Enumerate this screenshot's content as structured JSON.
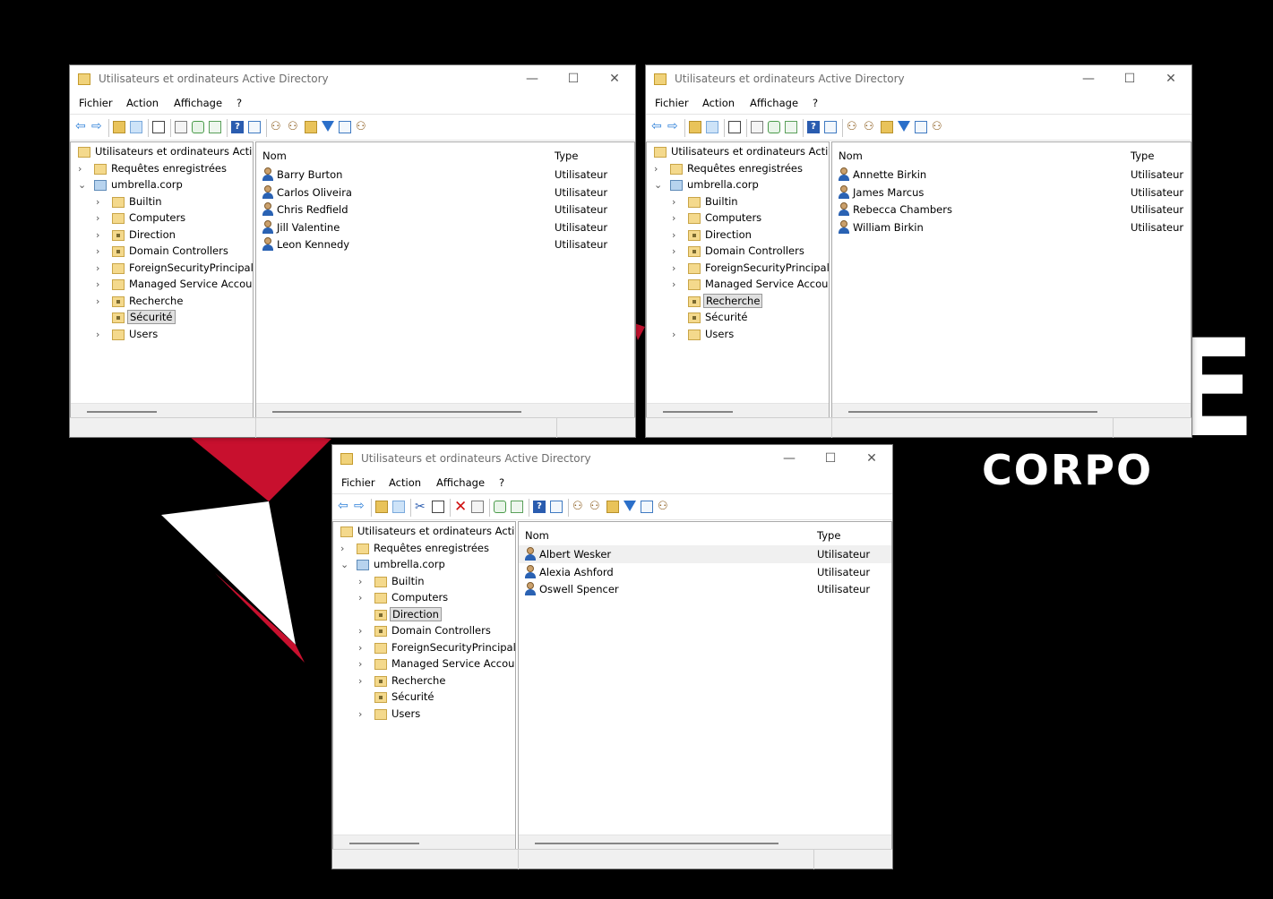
{
  "windows": [
    {
      "title": "Utilisateurs et ordinateurs Active Directory",
      "menu": [
        "Fichier",
        "Action",
        "Affichage",
        "?"
      ],
      "tree_root": "Utilisateurs et ordinateurs Active",
      "saved_queries": "Requêtes enregistrées",
      "domain": "umbrella.corp",
      "ous": [
        "Builtin",
        "Computers",
        "Direction",
        "Domain Controllers",
        "ForeignSecurityPrincipals",
        "Managed Service Accour",
        "Recherche",
        "Sécurité",
        "Users"
      ],
      "selected_ou": "Sécurité",
      "col_name": "Nom",
      "col_type": "Type",
      "rows": [
        {
          "name": "Barry Burton",
          "type": "Utilisateur"
        },
        {
          "name": "Carlos Oliveira",
          "type": "Utilisateur"
        },
        {
          "name": "Chris Redfield",
          "type": "Utilisateur"
        },
        {
          "name": "Jill Valentine",
          "type": "Utilisateur"
        },
        {
          "name": "Leon Kennedy",
          "type": "Utilisateur"
        }
      ]
    },
    {
      "title": "Utilisateurs et ordinateurs Active Directory",
      "menu": [
        "Fichier",
        "Action",
        "Affichage",
        "?"
      ],
      "tree_root": "Utilisateurs et ordinateurs Active",
      "saved_queries": "Requêtes enregistrées",
      "domain": "umbrella.corp",
      "ous": [
        "Builtin",
        "Computers",
        "Direction",
        "Domain Controllers",
        "ForeignSecurityPrincipals",
        "Managed Service Accour",
        "Recherche",
        "Sécurité",
        "Users"
      ],
      "selected_ou": "Recherche",
      "col_name": "Nom",
      "col_type": "Type",
      "rows": [
        {
          "name": "Annette Birkin",
          "type": "Utilisateur"
        },
        {
          "name": "James Marcus",
          "type": "Utilisateur"
        },
        {
          "name": "Rebecca Chambers",
          "type": "Utilisateur"
        },
        {
          "name": "William Birkin",
          "type": "Utilisateur"
        }
      ]
    },
    {
      "title": "Utilisateurs et ordinateurs Active Directory",
      "menu": [
        "Fichier",
        "Action",
        "Affichage",
        "?"
      ],
      "tree_root": "Utilisateurs et ordinateurs Active",
      "saved_queries": "Requêtes enregistrées",
      "domain": "umbrella.corp",
      "ous": [
        "Builtin",
        "Computers",
        "Direction",
        "Domain Controllers",
        "ForeignSecurityPrincipals",
        "Managed Service Accour",
        "Recherche",
        "Sécurité",
        "Users"
      ],
      "selected_ou": "Direction",
      "col_name": "Nom",
      "col_type": "Type",
      "rows": [
        {
          "name": "Albert Wesker",
          "type": "Utilisateur"
        },
        {
          "name": "Alexia Ashford",
          "type": "Utilisateur"
        },
        {
          "name": "Oswell Spencer",
          "type": "Utilisateur"
        }
      ]
    }
  ],
  "wallpaper": {
    "text_corp": "CORPO",
    "text_big": "E",
    "logo_red": "#c8102e",
    "logo_white": "#ffffff"
  }
}
